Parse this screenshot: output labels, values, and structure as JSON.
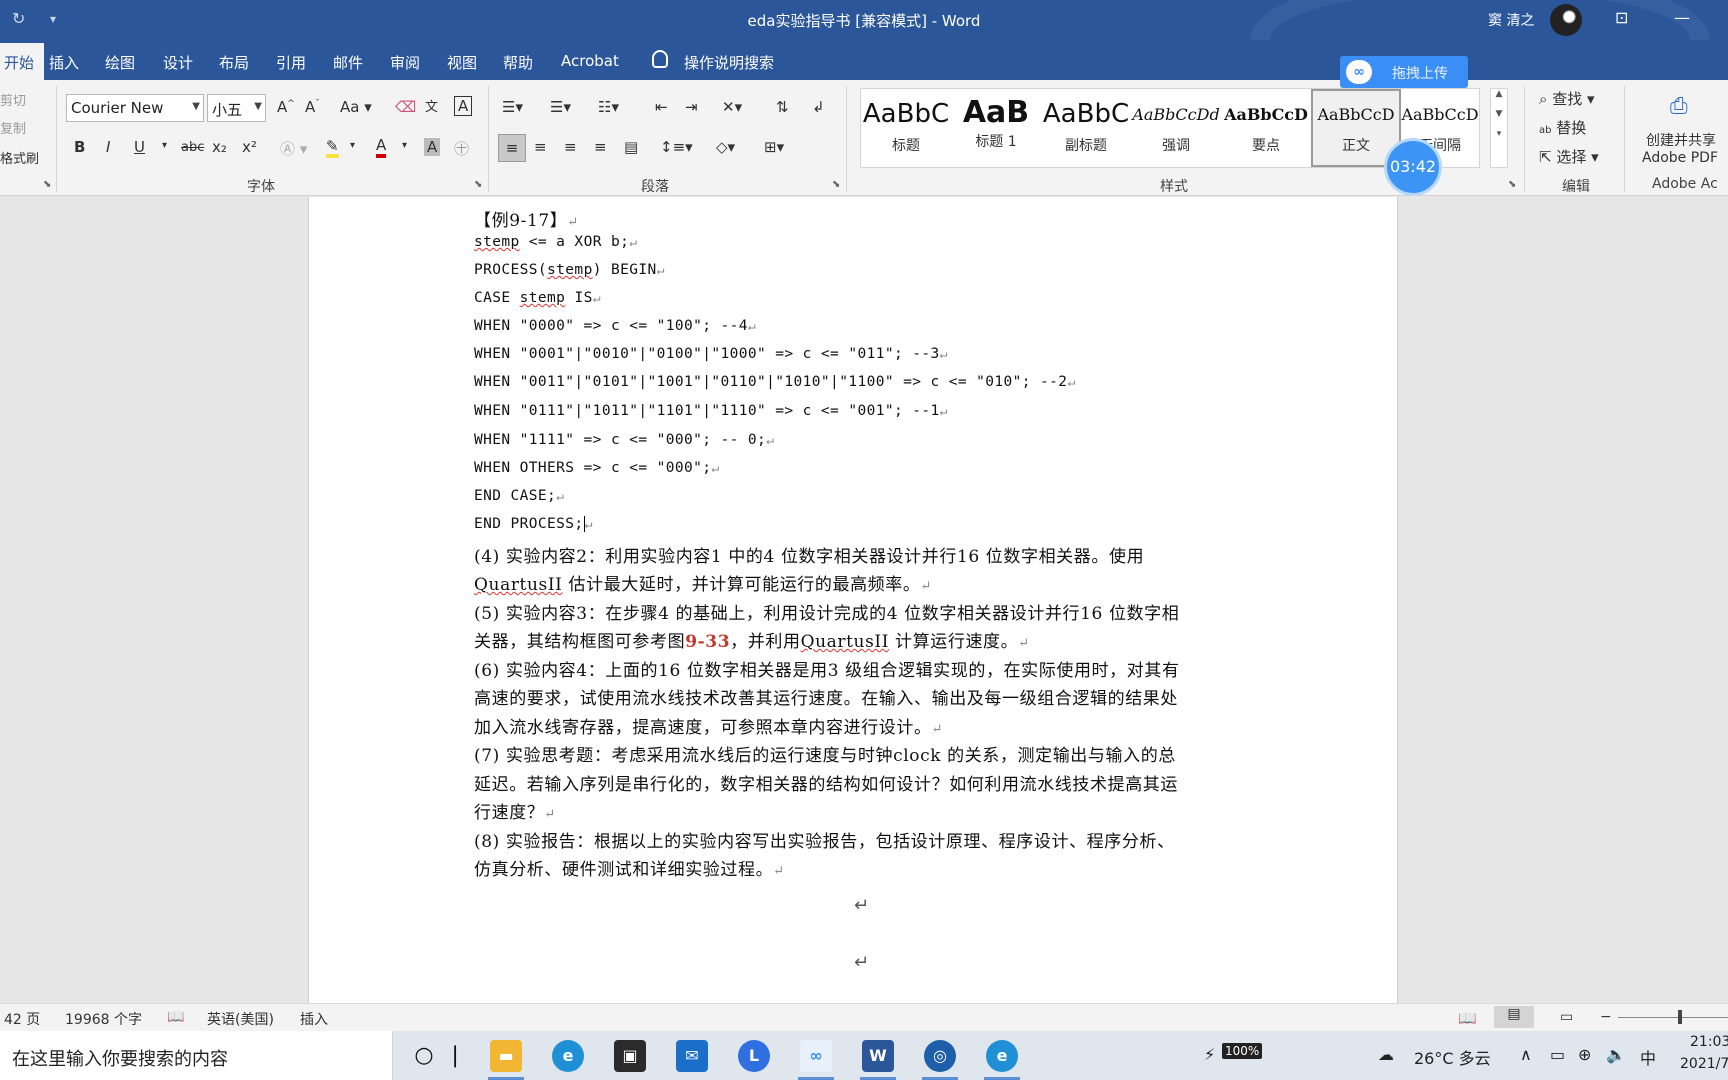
{
  "window": {
    "title": "eda实验指导书 [兼容模式] - Word",
    "user_name": "窦 清之"
  },
  "tabs": [
    {
      "label": "开始"
    },
    {
      "label": "插入"
    },
    {
      "label": "绘图"
    },
    {
      "label": "设计"
    },
    {
      "label": "布局"
    },
    {
      "label": "引用"
    },
    {
      "label": "邮件"
    },
    {
      "label": "审阅"
    },
    {
      "label": "视图"
    },
    {
      "label": "帮助"
    },
    {
      "label": "Acrobat"
    },
    {
      "label": "操作说明搜索"
    }
  ],
  "ribbon": {
    "clipboard": {
      "cut": "剪切",
      "copy": "复制",
      "format_painter": "格式刷"
    },
    "font": {
      "group_label": "字体",
      "font_name": "Courier New",
      "font_size": "小五",
      "grow": "A^",
      "shrink": "Aˇ",
      "case": "Aa",
      "bold": "B",
      "italic": "I",
      "underline": "U",
      "strike": "abc",
      "subscript": "x₂",
      "superscript": "x²"
    },
    "paragraph": {
      "group_label": "段落"
    },
    "styles": {
      "group_label": "样式",
      "items": [
        {
          "preview": "AaBbC",
          "name": "标题"
        },
        {
          "preview": "AaB",
          "name": "标题 1"
        },
        {
          "preview": "AaBbC",
          "name": "副标题"
        },
        {
          "preview": "AaBbCcDd",
          "name": "强调"
        },
        {
          "preview": "AaBbCcD",
          "name": "要点"
        },
        {
          "preview": "AaBbCcD",
          "name": "正文"
        },
        {
          "preview": "AaBbCcD",
          "name": "无间隔"
        }
      ]
    },
    "editing": {
      "group_label": "编辑",
      "find": "查找",
      "replace": "替换",
      "select": "选择"
    },
    "adobe": {
      "line1": "创建并共享",
      "line2": "Adobe PDF",
      "group_label": "Adobe Ac"
    }
  },
  "overlays": {
    "upload_label": "拖拽上传",
    "timer": "03:42"
  },
  "document": {
    "lines": [
      {
        "text": "【例9-17】"
      },
      {
        "parts": [
          "stemp",
          " <= a XOR b;"
        ]
      },
      {
        "parts": [
          "PROCESS(",
          "stemp",
          ") BEGIN"
        ]
      },
      {
        "parts": [
          "CASE ",
          "stemp",
          " IS"
        ]
      },
      {
        "text": "WHEN \"0000\" => c <= \"100\"; --4"
      },
      {
        "text": "WHEN \"0001\"|\"0010\"|\"0100\"|\"1000\" => c <= \"011\"; --3"
      },
      {
        "text": "WHEN \"0011\"|\"0101\"|\"1001\"|\"0110\"|\"1010\"|\"1100\" => c <= \"010\"; --2"
      },
      {
        "text": "WHEN \"0111\"|\"1011\"|\"1101\"|\"1110\" => c <= \"001\"; --1"
      },
      {
        "text": "WHEN \"1111\" => c <= \"000\"; -- 0;"
      },
      {
        "text": "WHEN OTHERS => c <= \"000\";"
      },
      {
        "text": "END CASE;"
      },
      {
        "text": "END PROCESS;"
      }
    ],
    "paragraphs": [
      {
        "line1": "(4)  实验内容2：利用实验内容1  中的4  位数字相关器设计并行16  位数字相关器。使用",
        "line2_a": "QuartusII",
        "line2_b": "  估计最大延时，并计算可能运行的最高频率。"
      },
      {
        "line1": "(5)  实验内容3：在步骤4  的基础上，利用设计完成的4  位数字相关器设计并行16  位数字相",
        "line2_a": "关器，其结构框图可参考图",
        "line2_ref": "9-33",
        "line2_b": "，并利用",
        "line2_c": "QuartusII",
        "line2_d": "  计算运行速度。"
      },
      {
        "line1": "(6)  实验内容4：上面的16  位数字相关器是用3  级组合逻辑实现的，在实际使用时，对其有",
        "line2": "高速的要求，试使用流水线技术改善其运行速度。在输入、输出及每一级组合逻辑的结果处",
        "line3": "加入流水线寄存器，提高速度，可参照本章内容进行设计。"
      },
      {
        "line1": "(7)  实验思考题：考虑采用流水线后的运行速度与时钟clock  的关系，测定输出与输入的总",
        "line2": "延迟。若输入序列是串行化的，数字相关器的结构如何设计？如何利用流水线技术提高其运",
        "line3": "行速度？"
      },
      {
        "line1": "(8)  实验报告：根据以上的实验内容写出实验报告，包括设计原理、程序设计、程序分析、",
        "line2": "仿真分析、硬件测试和详细实验过程。"
      }
    ],
    "para_mark": "↵"
  },
  "status": {
    "pages": "42 页",
    "words": "19968 个字",
    "language": "英语(美国)",
    "mode": "插入"
  },
  "taskbar": {
    "search_placeholder": "在这里输入你要搜索的内容",
    "battery": "100%",
    "weather": "26°C  多云",
    "ime": "中",
    "time": "21:03",
    "date": "2021/7"
  },
  "colors": {
    "word_blue": "#2b579a",
    "reference_red": "#c0392b",
    "upload_blue": "#3a8ef6"
  }
}
